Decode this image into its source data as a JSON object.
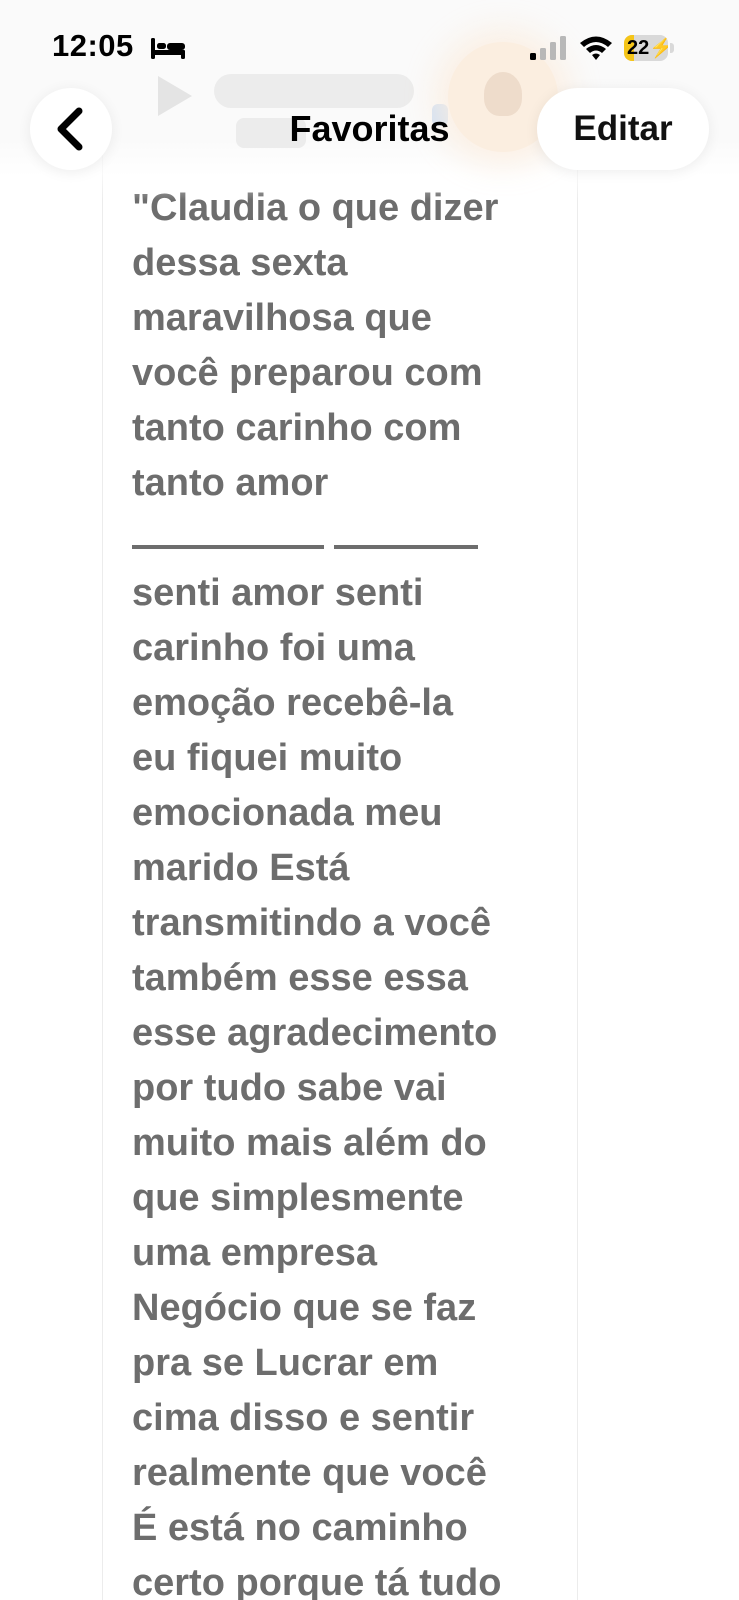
{
  "status_bar": {
    "time": "12:05",
    "battery_level_label": "22",
    "battery_fraction": 0.22,
    "icons": [
      "bed-icon",
      "signal-icon",
      "wifi-icon",
      "battery-charging-icon"
    ]
  },
  "nav": {
    "title": "Favoritas",
    "edit_label": "Editar",
    "back_icon": "chevron-left-icon"
  },
  "message": {
    "lines_before": [
      "\"Claudia o que dizer",
      "dessa sexta",
      "maravilhosa que",
      "você preparou com",
      "tanto carinho com",
      "tanto amor"
    ],
    "lines_after": [
      "senti amor senti",
      "carinho foi uma",
      "emoção recebê-la",
      "eu fiquei muito",
      "emocionada meu",
      "marido Está",
      "transmitindo a você",
      "também esse essa",
      "esse agradecimento",
      "por tudo sabe vai",
      "muito mais além do",
      "que simplesmente",
      "uma empresa",
      "Negócio que se faz",
      "pra se Lucrar em",
      "cima disso e sentir",
      "realmente que você",
      "É está no caminho",
      "certo porque tá tudo"
    ]
  },
  "colors": {
    "message_text": "#6d6d6d",
    "battery_fill": "#f5c518",
    "title_text": "#000000"
  }
}
